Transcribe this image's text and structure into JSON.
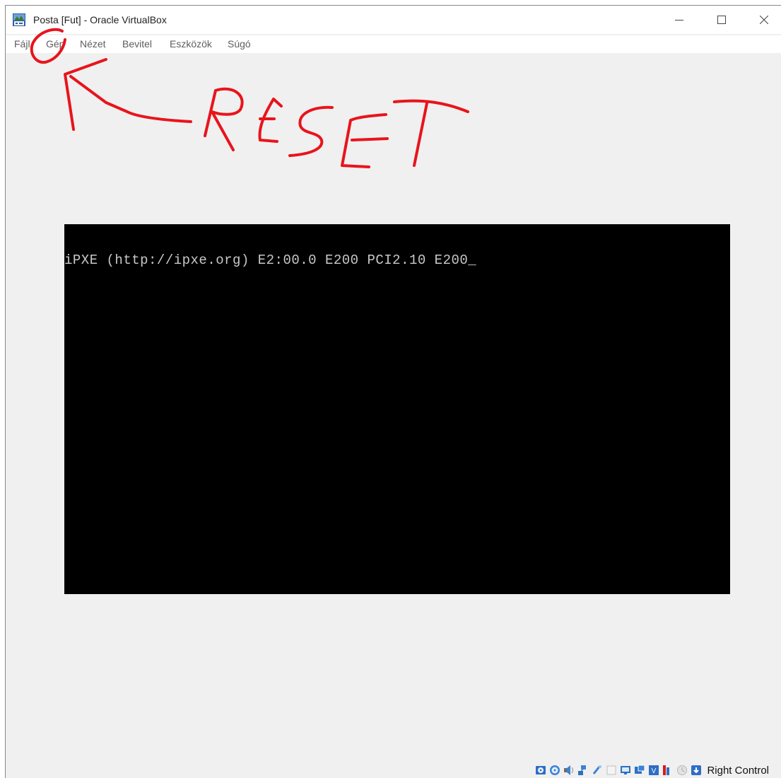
{
  "window": {
    "title": "Posta [Fut] - Oracle VirtualBox",
    "app_icon": "virtualbox-icon",
    "controls": [
      "minimize-icon",
      "maximize-icon",
      "close-icon"
    ]
  },
  "menu": {
    "items": [
      {
        "label": "Fájl"
      },
      {
        "label": "Gép"
      },
      {
        "label": "Nézet"
      },
      {
        "label": "Bevitel"
      },
      {
        "label": "Eszközök"
      },
      {
        "label": "Súgó"
      }
    ]
  },
  "vm_screen": {
    "console_text": "iPXE (http://ipxe.org) E2:00.0 E200 PCI2.10 E200",
    "cursor": "_"
  },
  "annotation": {
    "handwritten_text": "RESET",
    "color": "#e8141b"
  },
  "statusbar": {
    "icons": [
      "hard-disk-icon",
      "optical-drive-icon",
      "audio-icon",
      "network-icon",
      "usb-icon",
      "shared-folders-icon",
      "display-icon",
      "video-capture-icon",
      "virtualization-icon",
      "cpu-activity-icon",
      "mouse-integration-icon"
    ],
    "host_key": "Right Control"
  }
}
